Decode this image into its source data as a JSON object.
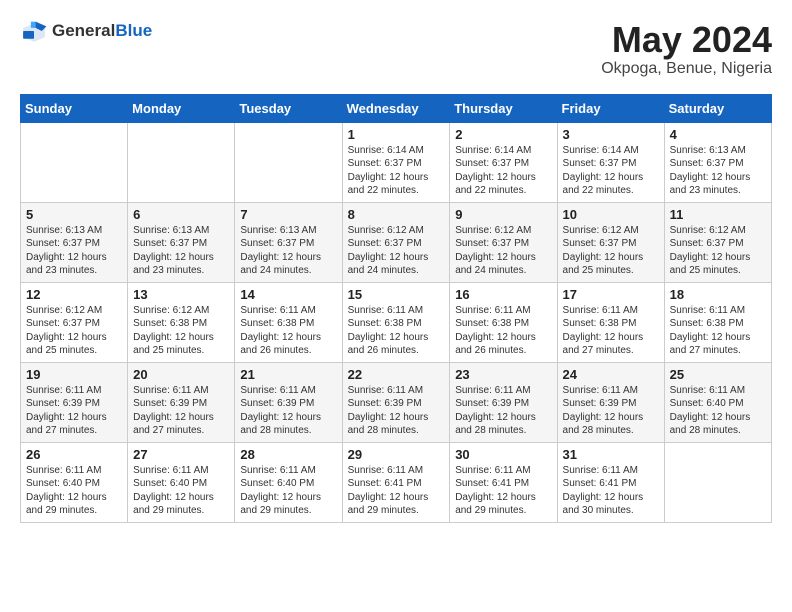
{
  "header": {
    "logo_general": "General",
    "logo_blue": "Blue",
    "month": "May 2024",
    "location": "Okpoga, Benue, Nigeria"
  },
  "weekdays": [
    "Sunday",
    "Monday",
    "Tuesday",
    "Wednesday",
    "Thursday",
    "Friday",
    "Saturday"
  ],
  "rows": [
    [
      {
        "day": "",
        "info": ""
      },
      {
        "day": "",
        "info": ""
      },
      {
        "day": "",
        "info": ""
      },
      {
        "day": "1",
        "info": "Sunrise: 6:14 AM\nSunset: 6:37 PM\nDaylight: 12 hours\nand 22 minutes."
      },
      {
        "day": "2",
        "info": "Sunrise: 6:14 AM\nSunset: 6:37 PM\nDaylight: 12 hours\nand 22 minutes."
      },
      {
        "day": "3",
        "info": "Sunrise: 6:14 AM\nSunset: 6:37 PM\nDaylight: 12 hours\nand 22 minutes."
      },
      {
        "day": "4",
        "info": "Sunrise: 6:13 AM\nSunset: 6:37 PM\nDaylight: 12 hours\nand 23 minutes."
      }
    ],
    [
      {
        "day": "5",
        "info": "Sunrise: 6:13 AM\nSunset: 6:37 PM\nDaylight: 12 hours\nand 23 minutes."
      },
      {
        "day": "6",
        "info": "Sunrise: 6:13 AM\nSunset: 6:37 PM\nDaylight: 12 hours\nand 23 minutes."
      },
      {
        "day": "7",
        "info": "Sunrise: 6:13 AM\nSunset: 6:37 PM\nDaylight: 12 hours\nand 24 minutes."
      },
      {
        "day": "8",
        "info": "Sunrise: 6:12 AM\nSunset: 6:37 PM\nDaylight: 12 hours\nand 24 minutes."
      },
      {
        "day": "9",
        "info": "Sunrise: 6:12 AM\nSunset: 6:37 PM\nDaylight: 12 hours\nand 24 minutes."
      },
      {
        "day": "10",
        "info": "Sunrise: 6:12 AM\nSunset: 6:37 PM\nDaylight: 12 hours\nand 25 minutes."
      },
      {
        "day": "11",
        "info": "Sunrise: 6:12 AM\nSunset: 6:37 PM\nDaylight: 12 hours\nand 25 minutes."
      }
    ],
    [
      {
        "day": "12",
        "info": "Sunrise: 6:12 AM\nSunset: 6:37 PM\nDaylight: 12 hours\nand 25 minutes."
      },
      {
        "day": "13",
        "info": "Sunrise: 6:12 AM\nSunset: 6:38 PM\nDaylight: 12 hours\nand 25 minutes."
      },
      {
        "day": "14",
        "info": "Sunrise: 6:11 AM\nSunset: 6:38 PM\nDaylight: 12 hours\nand 26 minutes."
      },
      {
        "day": "15",
        "info": "Sunrise: 6:11 AM\nSunset: 6:38 PM\nDaylight: 12 hours\nand 26 minutes."
      },
      {
        "day": "16",
        "info": "Sunrise: 6:11 AM\nSunset: 6:38 PM\nDaylight: 12 hours\nand 26 minutes."
      },
      {
        "day": "17",
        "info": "Sunrise: 6:11 AM\nSunset: 6:38 PM\nDaylight: 12 hours\nand 27 minutes."
      },
      {
        "day": "18",
        "info": "Sunrise: 6:11 AM\nSunset: 6:38 PM\nDaylight: 12 hours\nand 27 minutes."
      }
    ],
    [
      {
        "day": "19",
        "info": "Sunrise: 6:11 AM\nSunset: 6:39 PM\nDaylight: 12 hours\nand 27 minutes."
      },
      {
        "day": "20",
        "info": "Sunrise: 6:11 AM\nSunset: 6:39 PM\nDaylight: 12 hours\nand 27 minutes."
      },
      {
        "day": "21",
        "info": "Sunrise: 6:11 AM\nSunset: 6:39 PM\nDaylight: 12 hours\nand 28 minutes."
      },
      {
        "day": "22",
        "info": "Sunrise: 6:11 AM\nSunset: 6:39 PM\nDaylight: 12 hours\nand 28 minutes."
      },
      {
        "day": "23",
        "info": "Sunrise: 6:11 AM\nSunset: 6:39 PM\nDaylight: 12 hours\nand 28 minutes."
      },
      {
        "day": "24",
        "info": "Sunrise: 6:11 AM\nSunset: 6:39 PM\nDaylight: 12 hours\nand 28 minutes."
      },
      {
        "day": "25",
        "info": "Sunrise: 6:11 AM\nSunset: 6:40 PM\nDaylight: 12 hours\nand 28 minutes."
      }
    ],
    [
      {
        "day": "26",
        "info": "Sunrise: 6:11 AM\nSunset: 6:40 PM\nDaylight: 12 hours\nand 29 minutes."
      },
      {
        "day": "27",
        "info": "Sunrise: 6:11 AM\nSunset: 6:40 PM\nDaylight: 12 hours\nand 29 minutes."
      },
      {
        "day": "28",
        "info": "Sunrise: 6:11 AM\nSunset: 6:40 PM\nDaylight: 12 hours\nand 29 minutes."
      },
      {
        "day": "29",
        "info": "Sunrise: 6:11 AM\nSunset: 6:41 PM\nDaylight: 12 hours\nand 29 minutes."
      },
      {
        "day": "30",
        "info": "Sunrise: 6:11 AM\nSunset: 6:41 PM\nDaylight: 12 hours\nand 29 minutes."
      },
      {
        "day": "31",
        "info": "Sunrise: 6:11 AM\nSunset: 6:41 PM\nDaylight: 12 hours\nand 30 minutes."
      },
      {
        "day": "",
        "info": ""
      }
    ]
  ]
}
